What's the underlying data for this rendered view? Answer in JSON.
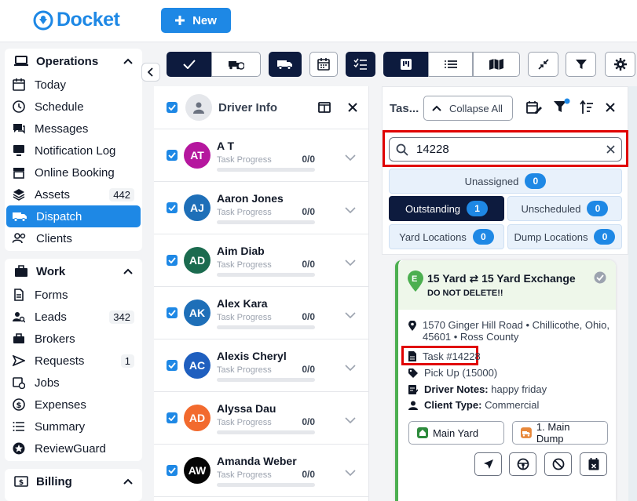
{
  "app": {
    "name": "Docket",
    "new_label": "New"
  },
  "sidebar": {
    "operations": {
      "title": "Operations",
      "items": [
        {
          "label": "Today"
        },
        {
          "label": "Schedule"
        },
        {
          "label": "Messages"
        },
        {
          "label": "Notification Log"
        },
        {
          "label": "Online Booking"
        },
        {
          "label": "Assets",
          "badge": "442"
        },
        {
          "label": "Dispatch",
          "active": true
        },
        {
          "label": "Clients"
        }
      ]
    },
    "work": {
      "title": "Work",
      "items": [
        {
          "label": "Forms"
        },
        {
          "label": "Leads",
          "badge": "342"
        },
        {
          "label": "Brokers"
        },
        {
          "label": "Requests",
          "badge": "1"
        },
        {
          "label": "Jobs"
        },
        {
          "label": "Expenses"
        },
        {
          "label": "Summary"
        },
        {
          "label": "ReviewGuard"
        }
      ]
    },
    "billing": {
      "title": "Billing"
    }
  },
  "driver_panel": {
    "title": "Driver Info",
    "progress_label": "Task Progress",
    "drivers": [
      {
        "initials": "AT",
        "name": "A T",
        "progress": "0/0",
        "color": "#b5179e"
      },
      {
        "initials": "AJ",
        "name": "Aaron Jones",
        "progress": "0/0",
        "color": "#1e6fb8"
      },
      {
        "initials": "AD",
        "name": "Aim Diab",
        "progress": "0/0",
        "color": "#1b6b4f"
      },
      {
        "initials": "AK",
        "name": "Alex Kara",
        "progress": "0/0",
        "color": "#1e6fb8"
      },
      {
        "initials": "AC",
        "name": "Alexis Cheryl",
        "progress": "0/0",
        "color": "#1f5fbf"
      },
      {
        "initials": "AD",
        "name": "Alyssa Dau",
        "progress": "0/0",
        "color": "#f26a2e"
      },
      {
        "initials": "AW",
        "name": "Amanda Weber",
        "progress": "0/0",
        "color": "#050505"
      }
    ]
  },
  "task_panel": {
    "title": "Tas...",
    "collapse_all": "Collapse All",
    "search_value": "14228",
    "filters": {
      "unassigned": {
        "label": "Unassigned",
        "count": "0"
      },
      "outstanding": {
        "label": "Outstanding",
        "count": "1"
      },
      "unscheduled": {
        "label": "Unscheduled",
        "count": "0"
      },
      "yard_locations": {
        "label": "Yard Locations",
        "count": "0"
      },
      "dump_locations": {
        "label": "Dump Locations",
        "count": "0"
      }
    },
    "task": {
      "badge": "E",
      "title_from": "15 Yard",
      "title_to": "15 Yard Exchange",
      "subtitle": "DO NOT DELETE!!",
      "address_line1": "1570 Ginger Hill Road • Chillicothe, Ohio,",
      "address_line2": "45601 • Ross County",
      "task_number": "Task #14228",
      "pickup": "Pick Up (15000)",
      "driver_notes_label": "Driver Notes:",
      "driver_notes": "happy friday",
      "client_type_label": "Client Type:",
      "client_type": "Commercial",
      "yard_button": "Main Yard",
      "dump_button": "1. Main Dump"
    }
  },
  "colors": {
    "accent": "#1e88e5",
    "navy": "#0d1b3e",
    "highlight": "#e00000"
  }
}
